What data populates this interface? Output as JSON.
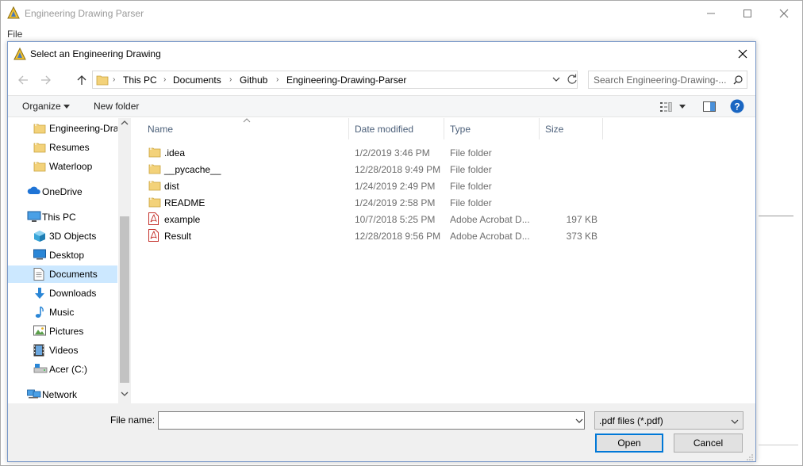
{
  "app": {
    "title": "Engineering Drawing Parser",
    "menu_file": "File"
  },
  "dialog": {
    "title": "Select an Engineering Drawing",
    "breadcrumbs": [
      "This PC",
      "Documents",
      "Github",
      "Engineering-Drawing-Parser"
    ],
    "search_placeholder": "Search Engineering-Drawing-...",
    "toolbar": {
      "organize": "Organize",
      "new_folder": "New folder"
    },
    "nav_items": [
      {
        "label": "Engineering-Dra",
        "icon": "folder-icon"
      },
      {
        "label": "Resumes",
        "icon": "folder-icon"
      },
      {
        "label": "Waterloop",
        "icon": "folder-icon"
      },
      {
        "label": "OneDrive",
        "icon": "onedrive-icon"
      },
      {
        "label": "This PC",
        "icon": "computer-icon"
      },
      {
        "label": "3D Objects",
        "icon": "3d-objects-icon"
      },
      {
        "label": "Desktop",
        "icon": "desktop-icon"
      },
      {
        "label": "Documents",
        "icon": "documents-icon",
        "selected": true
      },
      {
        "label": "Downloads",
        "icon": "downloads-icon"
      },
      {
        "label": "Music",
        "icon": "music-icon"
      },
      {
        "label": "Pictures",
        "icon": "pictures-icon"
      },
      {
        "label": "Videos",
        "icon": "videos-icon"
      },
      {
        "label": "Acer (C:)",
        "icon": "drive-icon"
      },
      {
        "label": "Network",
        "icon": "network-icon"
      }
    ],
    "columns": {
      "name": "Name",
      "date_modified": "Date modified",
      "type": "Type",
      "size": "Size"
    },
    "files": [
      {
        "name": ".idea",
        "date": "1/2/2019 3:46 PM",
        "type": "File folder",
        "size": "",
        "icon": "folder-icon"
      },
      {
        "name": "__pycache__",
        "date": "12/28/2018 9:49 PM",
        "type": "File folder",
        "size": "",
        "icon": "folder-icon"
      },
      {
        "name": "dist",
        "date": "1/24/2019 2:49 PM",
        "type": "File folder",
        "size": "",
        "icon": "folder-icon"
      },
      {
        "name": "README",
        "date": "1/24/2019 2:58 PM",
        "type": "File folder",
        "size": "",
        "icon": "folder-icon"
      },
      {
        "name": "example",
        "date": "10/7/2018 5:25 PM",
        "type": "Adobe Acrobat D...",
        "size": "197 KB",
        "icon": "pdf-icon"
      },
      {
        "name": "Result",
        "date": "12/28/2018 9:56 PM",
        "type": "Adobe Acrobat D...",
        "size": "373 KB",
        "icon": "pdf-icon"
      }
    ],
    "file_name_label": "File name:",
    "file_name_value": "",
    "file_type": ".pdf files (*.pdf)",
    "open_label": "Open",
    "cancel_label": "Cancel"
  },
  "colors": {
    "accent": "#0078d7",
    "selected_bg": "#cce8ff",
    "folder": "#f3d27a",
    "pdf": "#c4312b"
  }
}
